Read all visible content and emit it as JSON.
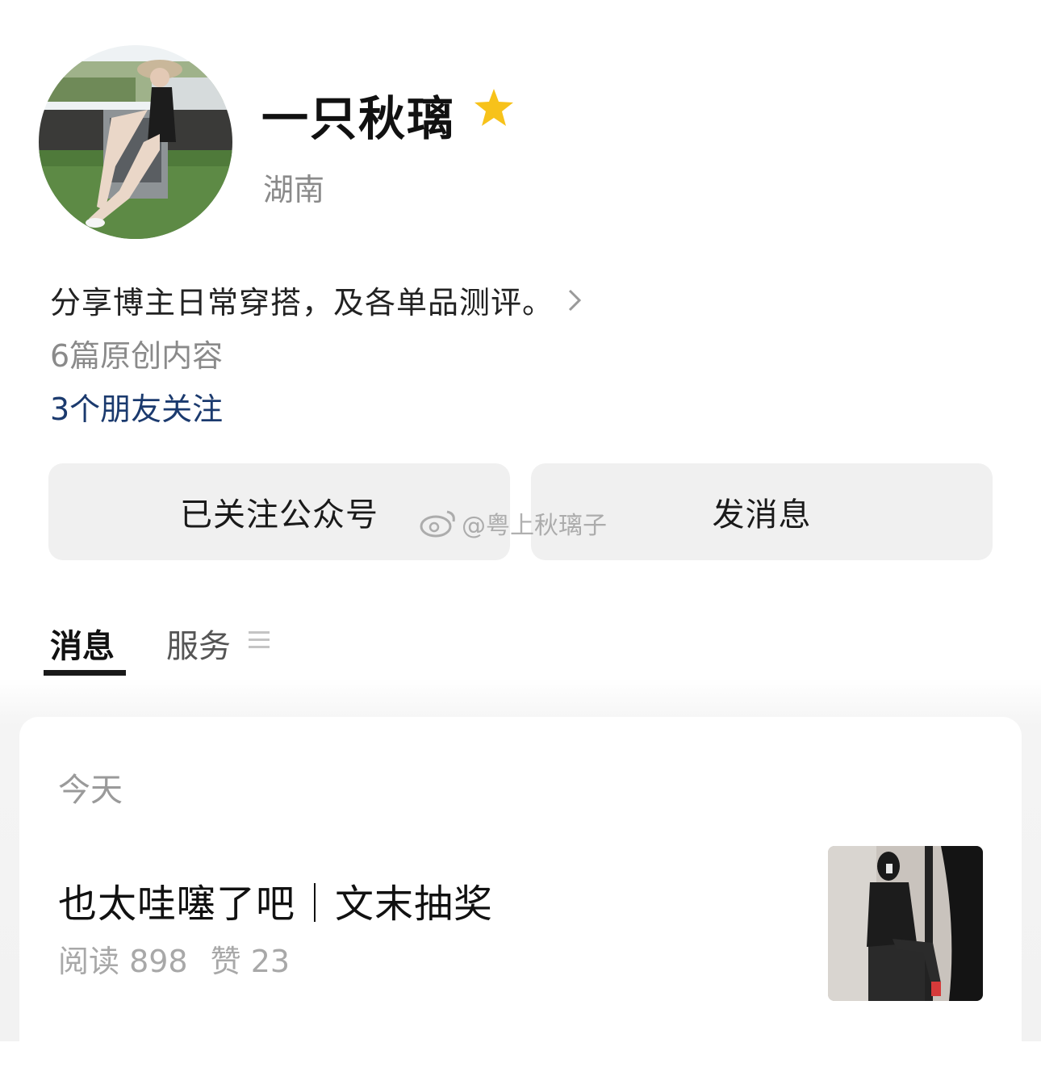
{
  "profile": {
    "name": "一只秋璃",
    "region": "湖南",
    "bio": "分享博主日常穿搭，及各单品测评。",
    "original_count": "6篇原创内容",
    "friends_follow": "3个朋友关注"
  },
  "actions": {
    "follow_label": "已关注公众号",
    "message_label": "发消息"
  },
  "watermark": "@粤上秋璃子",
  "tabs": [
    {
      "label": "消息",
      "active": true
    },
    {
      "label": "服务",
      "active": false
    }
  ],
  "feed": {
    "date": "今天",
    "article": {
      "title": "也太哇噻了吧｜文末抽奖",
      "reads": "阅读 898",
      "likes": "赞 23"
    }
  },
  "icons": [
    "star-icon",
    "chevron-right-icon",
    "weibo-icon",
    "menu-icon"
  ],
  "colors": {
    "star": "#f7c21a",
    "link": "#1b3a6e",
    "button_bg": "#f0f0f0"
  }
}
